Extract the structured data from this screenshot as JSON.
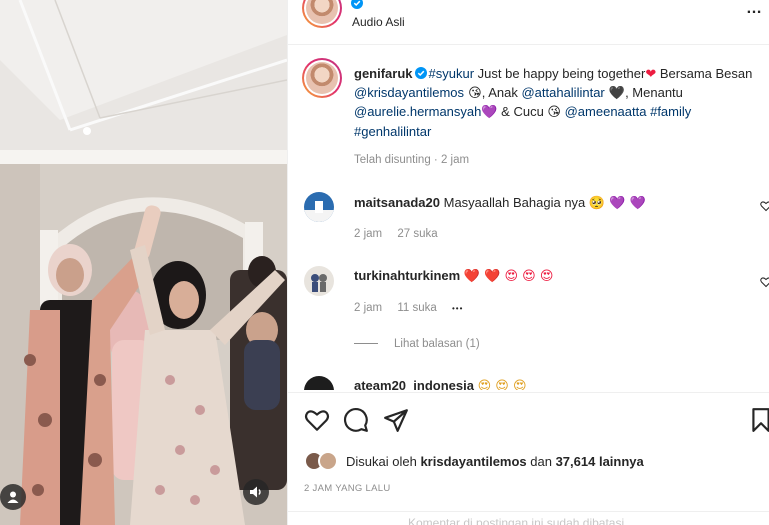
{
  "header": {
    "audio_label": "Audio Asli",
    "more": "…"
  },
  "caption": {
    "username": "genifaruk",
    "hashtag1": "#syukur",
    "text1": " Just be happy being together",
    "heart": "❤",
    "text2": "  Bersama Besan ",
    "mention1": "@krisdayantilemos",
    "emoji1": " 😘",
    "text3": ", Anak ",
    "mention2": "@attahalilintar",
    "black_heart": " 🖤",
    "text4": ", Menantu ",
    "mention3": "@aurelie.hermansyah",
    "purple_heart": "💜",
    "text5": "  & Cucu ",
    "emoji2": "😘",
    "text6": "  ",
    "mention4": "@ameenaatta",
    "space": " ",
    "hashtag2": "#family",
    "hashtag3": "#genhalilintar",
    "edited": "Telah disunting · 2 jam"
  },
  "comments": [
    {
      "username": "maitsanada20",
      "text": "Masyaallah Bahagia nya",
      "emojis": "🥺 💜 💜",
      "time": "2 jam",
      "likes": "27 suka"
    },
    {
      "username": "turkinahturkinem",
      "text": "",
      "emojis": "❤️ ❤️ 😍 😍 😍",
      "time": "2 jam",
      "likes": "11 suka",
      "options": "•••",
      "replies": "Lihat balasan (1)"
    },
    {
      "username": "ateam20_indonesia",
      "text": "",
      "emojis": "😍 😍 😍"
    }
  ],
  "likes": {
    "prefix": "Disukai oleh ",
    "user": "krisdayantilemos",
    "middle": " dan ",
    "count": "37,614 lainnya"
  },
  "time_ago": "2 JAM YANG LALU",
  "comment_bar": "Komentar di postingan ini sudah dibatasi.",
  "colors": {
    "link": "#00376b",
    "verified": "#0095f6",
    "muted": "#8e8e8e"
  }
}
